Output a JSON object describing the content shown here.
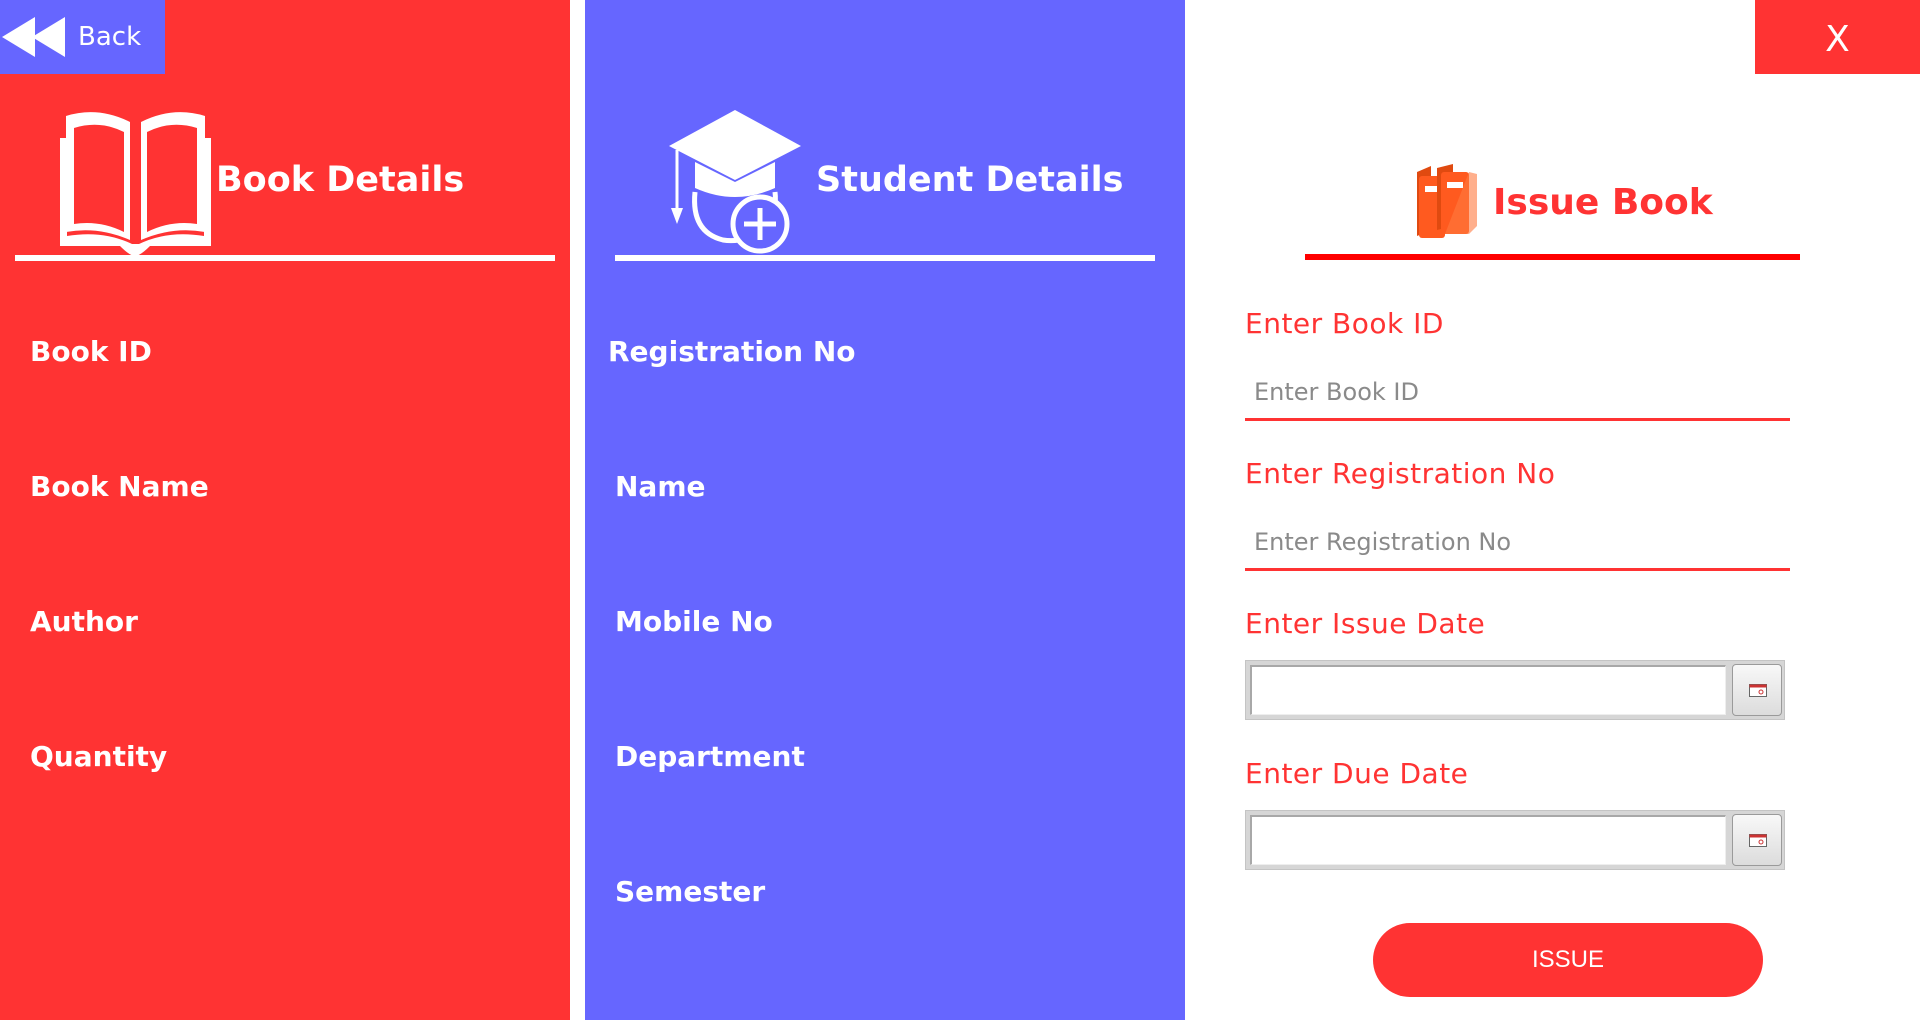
{
  "window": {
    "back_label": "Back",
    "close_label": "X"
  },
  "book_details": {
    "title": "Book Details",
    "fields": [
      "Book ID",
      "Book Name",
      "Author",
      "Quantity"
    ]
  },
  "student_details": {
    "title": "Student Details",
    "fields": [
      "Registration No",
      "Name",
      "Mobile No",
      "Department",
      "Semester"
    ]
  },
  "issue_book": {
    "title": "Issue Book",
    "book_id_label": "Enter Book ID",
    "book_id_placeholder": "Enter Book ID",
    "book_id_value": "",
    "reg_no_label": "Enter Registration No",
    "reg_no_placeholder": "Enter Registration No",
    "reg_no_value": "",
    "issue_date_label": "Enter Issue Date",
    "issue_date_value": "",
    "due_date_label": "Enter Due Date",
    "due_date_value": "",
    "submit_label": "ISSUE"
  },
  "colors": {
    "accent_red": "#ff3333",
    "accent_blue": "#6666ff",
    "books_icon": "#ff5a1f"
  },
  "icons": [
    "rewind-icon",
    "open-book-icon",
    "graduate-add-icon",
    "books-icon",
    "calendar-icon"
  ]
}
